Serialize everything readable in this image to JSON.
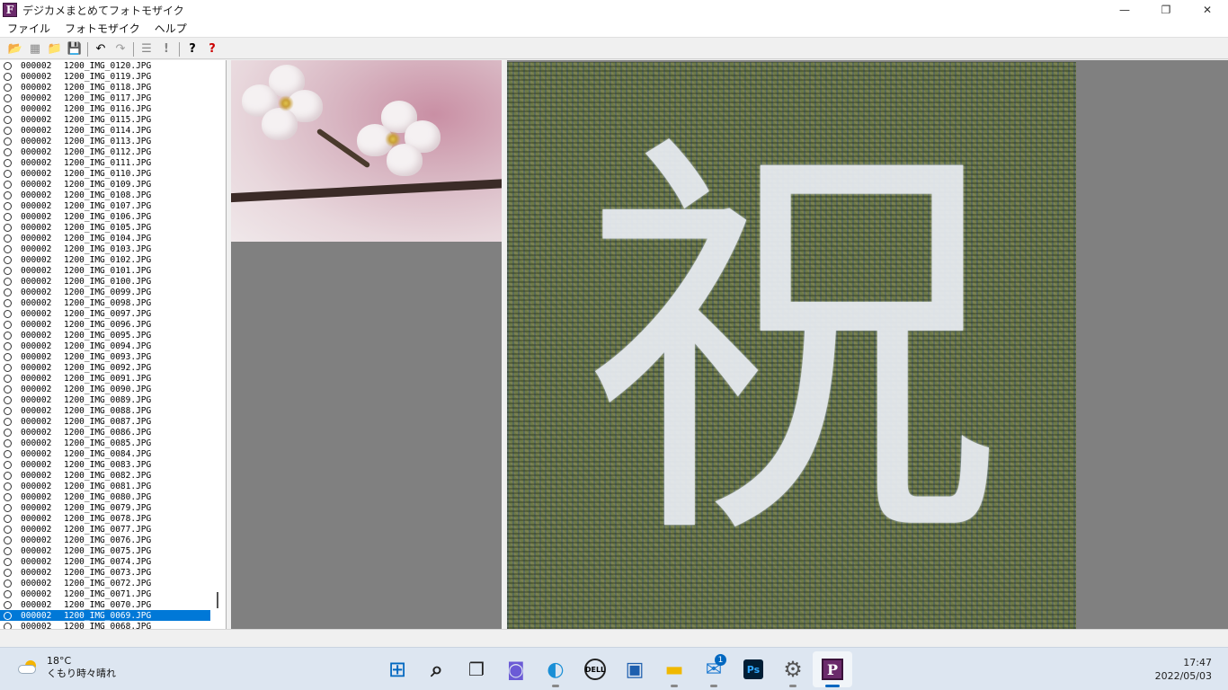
{
  "window": {
    "title": "デジカメまとめてフォトモザイク",
    "icon_letter": "F",
    "minimize": "—",
    "maximize": "❐",
    "close": "✕"
  },
  "menu": [
    "ファイル",
    "フォトモザイク",
    "ヘルプ"
  ],
  "toolbar": [
    {
      "name": "open-folder-icon",
      "glyph": "📂"
    },
    {
      "name": "image-icon",
      "glyph": "▦"
    },
    {
      "name": "folder-icon",
      "glyph": "📁"
    },
    {
      "name": "save-icon",
      "glyph": "💾"
    },
    {
      "name": "undo-icon",
      "glyph": "↶"
    },
    {
      "name": "redo-icon",
      "glyph": "↷"
    },
    {
      "name": "list-icon",
      "glyph": "☰"
    },
    {
      "name": "exclamation-icon",
      "glyph": "!"
    },
    {
      "name": "help-icon",
      "glyph": "?"
    },
    {
      "name": "context-help-icon",
      "glyph": "?"
    }
  ],
  "file_list": [
    {
      "code": "000002",
      "file": "1200_IMG_0120.JPG"
    },
    {
      "code": "000002",
      "file": "1200_IMG_0119.JPG"
    },
    {
      "code": "000002",
      "file": "1200_IMG_0118.JPG"
    },
    {
      "code": "000002",
      "file": "1200_IMG_0117.JPG"
    },
    {
      "code": "000002",
      "file": "1200_IMG_0116.JPG"
    },
    {
      "code": "000002",
      "file": "1200_IMG_0115.JPG"
    },
    {
      "code": "000002",
      "file": "1200_IMG_0114.JPG"
    },
    {
      "code": "000002",
      "file": "1200_IMG_0113.JPG"
    },
    {
      "code": "000002",
      "file": "1200_IMG_0112.JPG"
    },
    {
      "code": "000002",
      "file": "1200_IMG_0111.JPG"
    },
    {
      "code": "000002",
      "file": "1200_IMG_0110.JPG"
    },
    {
      "code": "000002",
      "file": "1200_IMG_0109.JPG"
    },
    {
      "code": "000002",
      "file": "1200_IMG_0108.JPG"
    },
    {
      "code": "000002",
      "file": "1200_IMG_0107.JPG"
    },
    {
      "code": "000002",
      "file": "1200_IMG_0106.JPG"
    },
    {
      "code": "000002",
      "file": "1200_IMG_0105.JPG"
    },
    {
      "code": "000002",
      "file": "1200_IMG_0104.JPG"
    },
    {
      "code": "000002",
      "file": "1200_IMG_0103.JPG"
    },
    {
      "code": "000002",
      "file": "1200_IMG_0102.JPG"
    },
    {
      "code": "000002",
      "file": "1200_IMG_0101.JPG"
    },
    {
      "code": "000002",
      "file": "1200_IMG_0100.JPG"
    },
    {
      "code": "000002",
      "file": "1200_IMG_0099.JPG"
    },
    {
      "code": "000002",
      "file": "1200_IMG_0098.JPG"
    },
    {
      "code": "000002",
      "file": "1200_IMG_0097.JPG"
    },
    {
      "code": "000002",
      "file": "1200_IMG_0096.JPG"
    },
    {
      "code": "000002",
      "file": "1200_IMG_0095.JPG"
    },
    {
      "code": "000002",
      "file": "1200_IMG_0094.JPG"
    },
    {
      "code": "000002",
      "file": "1200_IMG_0093.JPG"
    },
    {
      "code": "000002",
      "file": "1200_IMG_0092.JPG"
    },
    {
      "code": "000002",
      "file": "1200_IMG_0091.JPG"
    },
    {
      "code": "000002",
      "file": "1200_IMG_0090.JPG"
    },
    {
      "code": "000002",
      "file": "1200_IMG_0089.JPG"
    },
    {
      "code": "000002",
      "file": "1200_IMG_0088.JPG"
    },
    {
      "code": "000002",
      "file": "1200_IMG_0087.JPG"
    },
    {
      "code": "000002",
      "file": "1200_IMG_0086.JPG"
    },
    {
      "code": "000002",
      "file": "1200_IMG_0085.JPG"
    },
    {
      "code": "000002",
      "file": "1200_IMG_0084.JPG"
    },
    {
      "code": "000002",
      "file": "1200_IMG_0083.JPG"
    },
    {
      "code": "000002",
      "file": "1200_IMG_0082.JPG"
    },
    {
      "code": "000002",
      "file": "1200_IMG_0081.JPG"
    },
    {
      "code": "000002",
      "file": "1200_IMG_0080.JPG"
    },
    {
      "code": "000002",
      "file": "1200_IMG_0079.JPG"
    },
    {
      "code": "000002",
      "file": "1200_IMG_0078.JPG"
    },
    {
      "code": "000002",
      "file": "1200_IMG_0077.JPG"
    },
    {
      "code": "000002",
      "file": "1200_IMG_0076.JPG"
    },
    {
      "code": "000002",
      "file": "1200_IMG_0075.JPG"
    },
    {
      "code": "000002",
      "file": "1200_IMG_0074.JPG"
    },
    {
      "code": "000002",
      "file": "1200_IMG_0073.JPG"
    },
    {
      "code": "000002",
      "file": "1200_IMG_0072.JPG"
    },
    {
      "code": "000002",
      "file": "1200_IMG_0071.JPG"
    },
    {
      "code": "000002",
      "file": "1200_IMG_0070.JPG"
    },
    {
      "code": "000002",
      "file": "1200_IMG_0069.JPG",
      "selected": true
    },
    {
      "code": "000002",
      "file": "1200_IMG_0068.JPG"
    }
  ],
  "mosaic": {
    "kanji": "祝"
  },
  "colors": {
    "selection": "#0078d7",
    "pane_gray": "#808080"
  },
  "taskbar": {
    "weather_temp": "18°C",
    "weather_desc": "くもり時々晴れ",
    "time": "17:47",
    "date": "2022/05/03",
    "mail_badge": "1",
    "apps": [
      {
        "name": "start-icon",
        "glyph": "⊞"
      },
      {
        "name": "search-icon",
        "glyph": "⌕"
      },
      {
        "name": "task-view-icon",
        "glyph": "❐"
      },
      {
        "name": "chat-icon",
        "glyph": "◙"
      },
      {
        "name": "edge-icon",
        "glyph": "◐"
      },
      {
        "name": "dell-icon",
        "glyph": "DELL"
      },
      {
        "name": "store-icon",
        "glyph": "▣"
      },
      {
        "name": "file-explorer-icon",
        "glyph": "▬"
      },
      {
        "name": "mail-icon",
        "glyph": "✉"
      },
      {
        "name": "photoshop-icon",
        "glyph": "Ps"
      },
      {
        "name": "settings-icon",
        "glyph": "⚙"
      },
      {
        "name": "photomosaic-app-icon",
        "glyph": "P"
      }
    ]
  }
}
